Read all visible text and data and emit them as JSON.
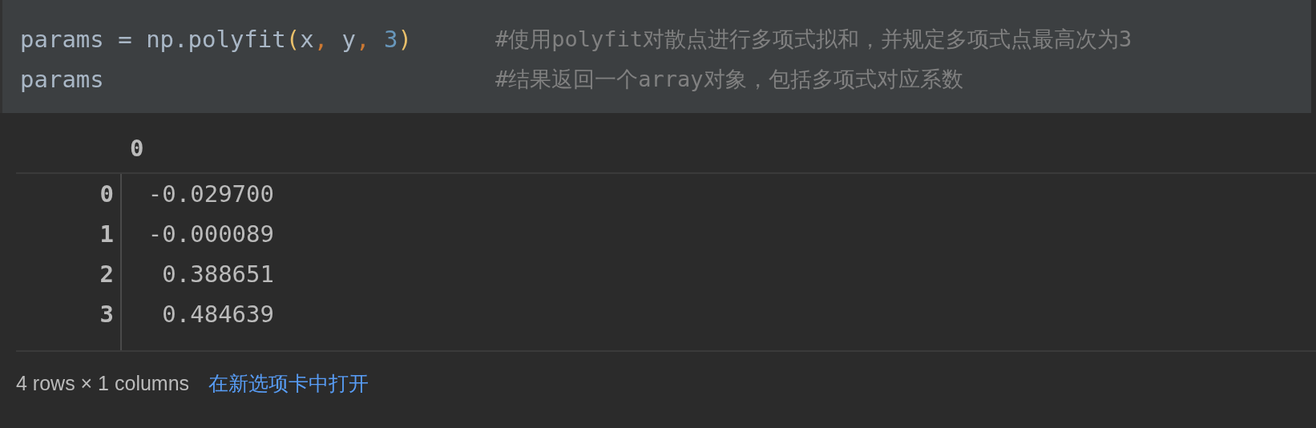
{
  "code_cell": {
    "lines": [
      {
        "tokens": [
          {
            "kind": "plain",
            "text": "params = np.polyfit"
          },
          {
            "kind": "paren",
            "text": "("
          },
          {
            "kind": "plain",
            "text": "x"
          },
          {
            "kind": "comma",
            "text": ", "
          },
          {
            "kind": "plain",
            "text": "y"
          },
          {
            "kind": "comma",
            "text": ", "
          },
          {
            "kind": "number",
            "text": "3"
          },
          {
            "kind": "paren",
            "text": ")"
          }
        ],
        "comment": "#使用polyfit对散点进行多项式拟和，并规定多项式点最高次为3"
      },
      {
        "tokens": [
          {
            "kind": "plain",
            "text": "params"
          }
        ],
        "comment": "#结果返回一个array对象，包括多项式对应系数"
      }
    ]
  },
  "table": {
    "columns": [
      "0"
    ],
    "rows": [
      {
        "index": "0",
        "values": [
          "-0.029700"
        ]
      },
      {
        "index": "1",
        "values": [
          "-0.000089"
        ]
      },
      {
        "index": "2",
        "values": [
          "0.388651"
        ]
      },
      {
        "index": "3",
        "values": [
          "0.484639"
        ]
      }
    ]
  },
  "footer": {
    "shape": "4 rows × 1 columns",
    "link": "在新选项卡中打开"
  }
}
